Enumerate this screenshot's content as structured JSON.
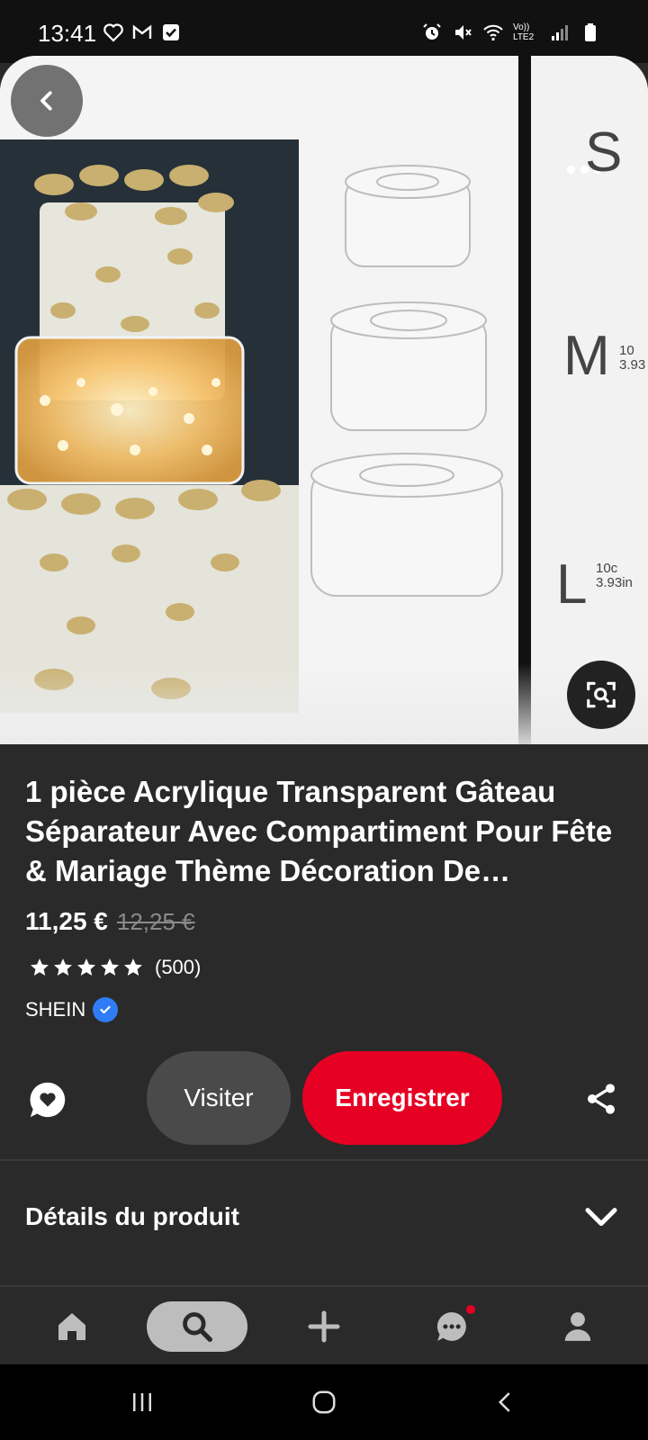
{
  "status_bar": {
    "time": "13:41",
    "left_icons": [
      "heart-outline-icon",
      "gmail-icon",
      "checkbox-icon"
    ],
    "right_icons": [
      "alarm-icon",
      "mute-icon",
      "wifi-icon",
      "volte-icon",
      "signal-icon",
      "battery-icon"
    ],
    "volte_label": "Vo)) LTE2"
  },
  "gallery": {
    "size_labels": [
      {
        "letter": "S",
        "detail": ""
      },
      {
        "letter": "M",
        "detail": "10 3.93"
      },
      {
        "letter": "L",
        "detail": "10c 3.93in"
      }
    ],
    "back_icon": "chevron-left-icon",
    "lens_icon": "visual-search-icon"
  },
  "product": {
    "title": "1 pièce Acrylique Transparent Gâteau Séparateur Avec Compartiment Pour Fête & Mariage Thème Décoration De…",
    "price": "11,25 €",
    "old_price": "12,25 €",
    "rating_stars": 5,
    "rating_count": "(500)",
    "shop_name": "SHEIN",
    "verified": true
  },
  "actions": {
    "visit_label": "Visiter",
    "save_label": "Enregistrer",
    "save_color": "#e60023"
  },
  "details": {
    "label": "Détails du produit"
  },
  "bottom_nav": {
    "items": [
      "home-icon",
      "search-icon",
      "add-icon",
      "messages-icon",
      "profile-icon"
    ],
    "active": "search-icon",
    "has_notification": "messages-icon"
  },
  "system_nav": [
    "recents-icon",
    "home-button-icon",
    "back-icon"
  ]
}
